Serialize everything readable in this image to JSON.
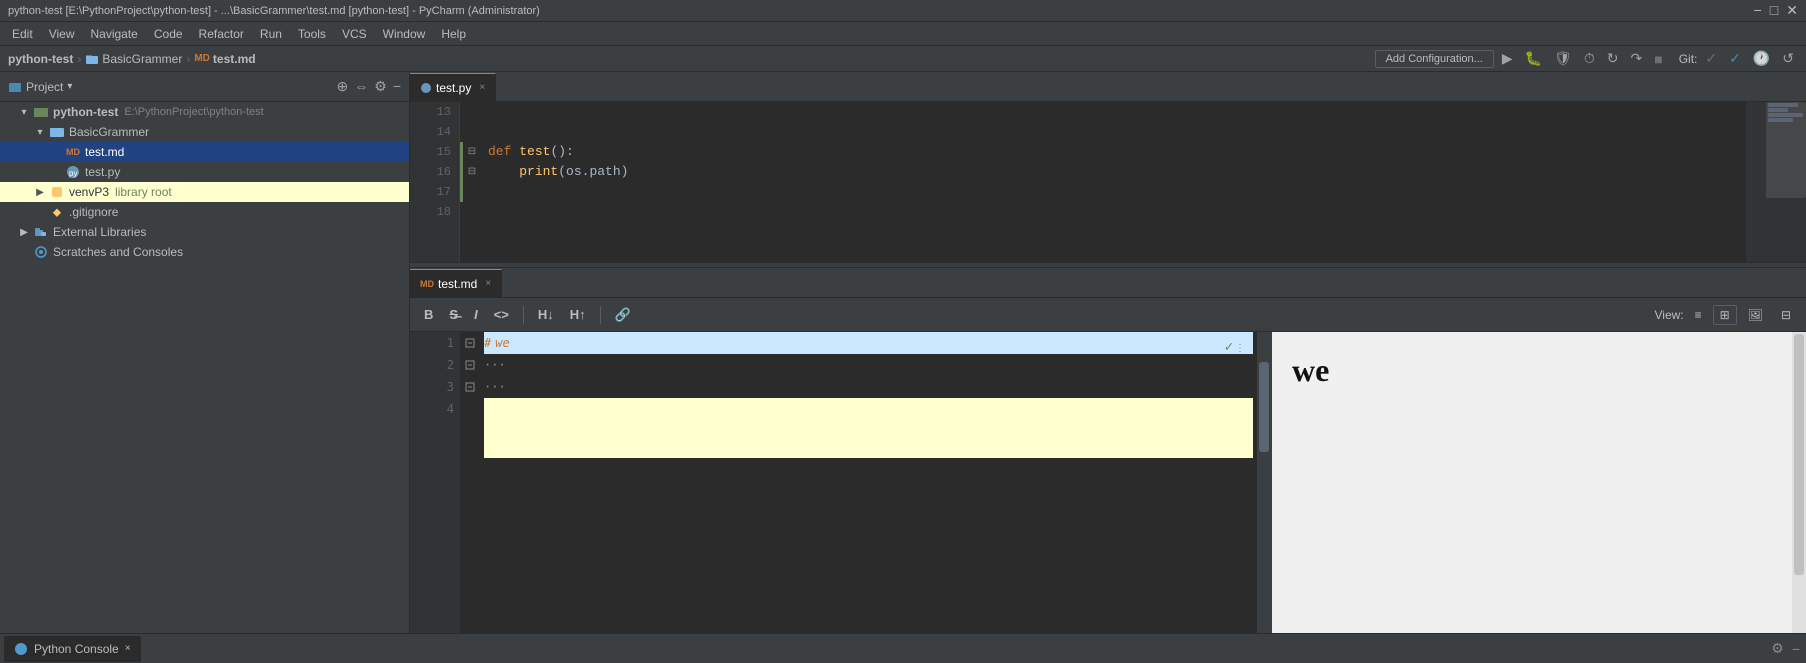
{
  "title_bar": {
    "text": "python-test [E:\\PythonProject\\python-test] - ...\\BasicGrammer\\test.md [python-test] - PyCharm (Administrator)",
    "minimize": "−",
    "maximize": "□",
    "close": "✕"
  },
  "menu": {
    "items": [
      "Edit",
      "View",
      "Navigate",
      "Code",
      "Refactor",
      "Run",
      "Tools",
      "VCS",
      "Window",
      "Help"
    ]
  },
  "breadcrumb": {
    "items": [
      "python-test",
      "BasicGrammer",
      "test.md"
    ],
    "separators": [
      ">",
      ">"
    ]
  },
  "toolbar": {
    "add_config": "Add Configuration...",
    "git_label": "Git:"
  },
  "sidebar": {
    "title": "Project",
    "tree": [
      {
        "id": "python-test",
        "label": "python-test",
        "sublabel": "E:\\PythonProject\\python-test",
        "type": "root",
        "indent": 0,
        "expanded": true,
        "arrow": "▾"
      },
      {
        "id": "BasicGrammer",
        "label": "BasicGrammer",
        "type": "folder",
        "indent": 1,
        "expanded": true,
        "arrow": "▾"
      },
      {
        "id": "test.md",
        "label": "test.md",
        "type": "md",
        "indent": 2,
        "expanded": false,
        "selected": true
      },
      {
        "id": "test.py",
        "label": "test.py",
        "type": "python",
        "indent": 2,
        "expanded": false
      },
      {
        "id": "venvP3",
        "label": "venvP3",
        "sublabel": "library root",
        "type": "venv",
        "indent": 1,
        "expanded": false,
        "arrow": "▶"
      },
      {
        "id": ".gitignore",
        "label": ".gitignore",
        "type": "gitignore",
        "indent": 1
      },
      {
        "id": "External Libraries",
        "label": "External Libraries",
        "type": "library",
        "indent": 0,
        "arrow": "▶"
      },
      {
        "id": "Scratches and Consoles",
        "label": "Scratches and Consoles",
        "type": "scratches",
        "indent": 0
      }
    ]
  },
  "editors": {
    "top_tab": {
      "label": "test.py",
      "close": "×",
      "active": true
    },
    "code_lines": [
      {
        "num": 13,
        "content": "",
        "type": "empty"
      },
      {
        "num": 14,
        "content": "",
        "type": "empty"
      },
      {
        "num": 15,
        "content": "def test():",
        "type": "code"
      },
      {
        "num": 16,
        "content": "    print(os.path)",
        "type": "code"
      },
      {
        "num": 17,
        "content": "",
        "type": "empty"
      },
      {
        "num": 18,
        "content": "",
        "type": "empty"
      }
    ],
    "md_tab": {
      "label": "test.md",
      "close": "×"
    },
    "md_toolbar": {
      "bold": "B",
      "strike": "S̶",
      "italic": "I",
      "code": "<>",
      "h_down": "H↓",
      "h_up": "H↑",
      "link": "🔗",
      "view_label": "View:",
      "view_list": "≡",
      "view_split": "⊞",
      "view_preview": "🖼",
      "view_vertical": "⊟"
    },
    "md_lines": [
      {
        "num": 1,
        "content": "# we",
        "type": "heading",
        "gutter": "check"
      },
      {
        "num": 2,
        "content": "···",
        "type": "dots"
      },
      {
        "num": 3,
        "content": "···",
        "type": "dots"
      },
      {
        "num": 4,
        "content": "",
        "type": "active"
      }
    ],
    "md_preview_text": "we"
  },
  "bottom_panel": {
    "tab_label": "Python Console",
    "tab_close": "×",
    "gear_icon": "⚙",
    "minus_icon": "−"
  }
}
